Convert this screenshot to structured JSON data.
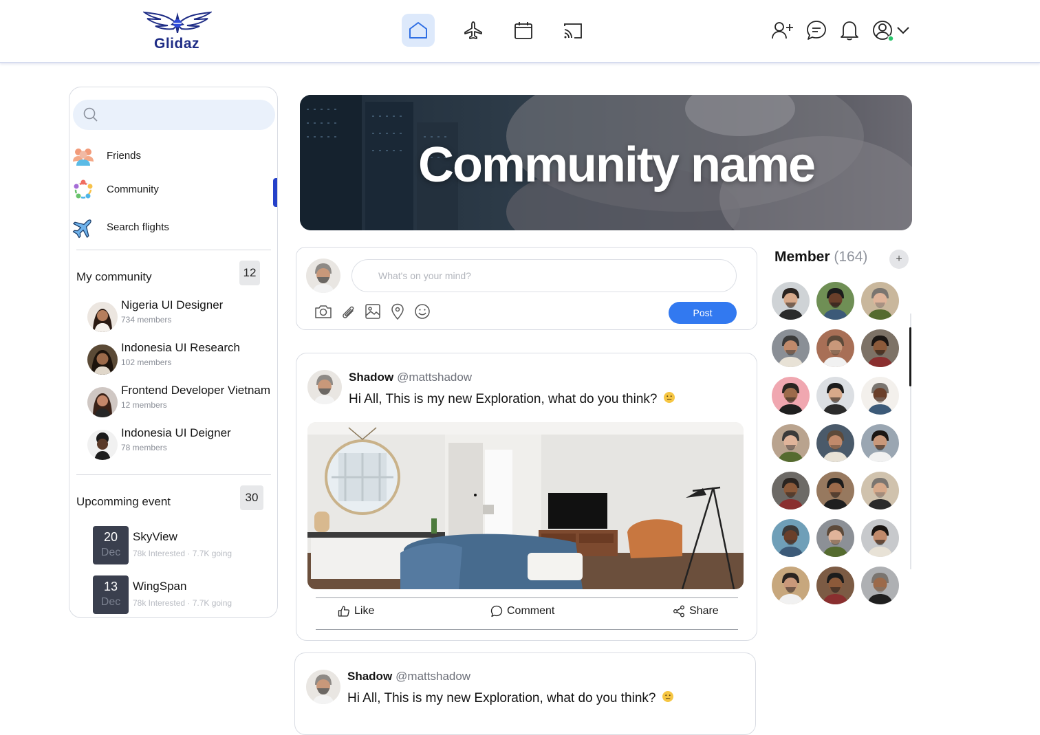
{
  "brand": {
    "name": "Glidaz"
  },
  "nav": {
    "center": [
      {
        "icon": "home-icon",
        "active": true
      },
      {
        "icon": "airplane-icon",
        "active": false
      },
      {
        "icon": "calendar-icon",
        "active": false
      },
      {
        "icon": "cast-icon",
        "active": false
      }
    ],
    "right": [
      "add-friend-icon",
      "chat-icon",
      "bell-icon",
      "profile-icon",
      "chevron-down-icon"
    ]
  },
  "sidebar": {
    "search_placeholder": "",
    "items": [
      {
        "label": "Friends",
        "icon": "friends-icon"
      },
      {
        "label": "Community",
        "icon": "community-icon",
        "active": true
      },
      {
        "label": "Search flights",
        "icon": "plane-icon"
      }
    ],
    "my_community": {
      "title": "My community",
      "count": "12",
      "items": [
        {
          "name": "Nigeria UI Designer",
          "members": "734 members"
        },
        {
          "name": "Indonesia UI Research",
          "members": "102 members"
        },
        {
          "name": "Frontend Developer Vietnam",
          "members": "12 members"
        },
        {
          "name": "Indonesia UI Deigner",
          "members": "78 members"
        }
      ]
    },
    "events": {
      "title": "Upcomming event",
      "count": "30",
      "items": [
        {
          "day": "20",
          "month": "Dec",
          "name": "SkyView",
          "meta": "78k Interested · 7.7K going"
        },
        {
          "day": "13",
          "month": "Dec",
          "name": "WingSpan",
          "meta": "78k Interested · 7.7K going"
        }
      ]
    }
  },
  "banner": {
    "title": "Community name"
  },
  "composer": {
    "placeholder": "What's on your mind?",
    "post_label": "Post",
    "tools": [
      "camera-icon",
      "attachment-icon",
      "image-icon",
      "location-icon",
      "emoji-icon"
    ]
  },
  "posts": [
    {
      "name": "Shadow",
      "handle": "@mattshadow",
      "text": "Hi All, This is my new Exploration, what do you think?",
      "actions": {
        "like": "Like",
        "comment": "Comment",
        "share": "Share"
      }
    },
    {
      "name": "Shadow",
      "handle": "@mattshadow",
      "text": "Hi All, This is my new Exploration, what do you think?"
    }
  ],
  "members": {
    "title": "Member",
    "count": "(164)",
    "add_label": "+",
    "total_shown": 21
  },
  "colors": {
    "accent": "#3279f0",
    "brand": "#1f2d86",
    "active_bar": "#2541c9",
    "nav_active_bg": "#dde9fb"
  }
}
